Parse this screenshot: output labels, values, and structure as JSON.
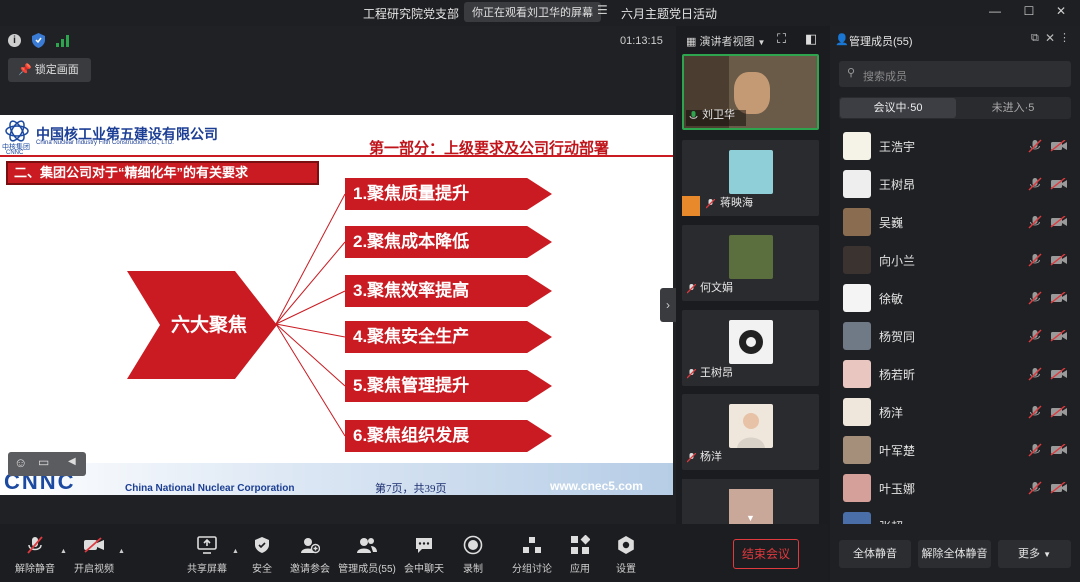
{
  "titlebar": {
    "meeting_org": "工程研究院党支部",
    "viewing_notice": "你正在观看刘卫华的屏幕",
    "meeting_title": "六月主题党日活动"
  },
  "stage": {
    "timer": "01:13:15",
    "lock_label": "锁定画面"
  },
  "view_controls": {
    "speaker_view": "演讲者视图"
  },
  "slide": {
    "company_cn": "中国核工业第五建设有限公司",
    "company_en": "China Nuclear Industry Fifth Construction CO., LTD.",
    "logo_group": "中核集团",
    "logo_cnnc": "CNNC",
    "part_title": "第一部分：上级要求及公司行动部署",
    "section_title": "二、集团公司对于“精细化年”的有关要求",
    "center_label": "六大聚焦",
    "items": [
      "1.聚焦质量提升",
      "2.聚焦成本降低",
      "3.聚焦效率提高",
      "4.聚焦安全生产",
      "5.聚焦管理提升",
      "6.聚焦组织发展"
    ],
    "footer_logo": "CNNC",
    "footer_corp": "China National Nuclear Corporation",
    "footer_page": "第7页，共39页",
    "footer_url": "www.cnec5.com"
  },
  "thumbnails": [
    {
      "name": "刘卫华",
      "active": true
    },
    {
      "name": "蒋映海"
    },
    {
      "name": "何文娟"
    },
    {
      "name": "王树昂"
    },
    {
      "name": "杨洋"
    }
  ],
  "members_panel": {
    "title": "管理成员(55)",
    "search_placeholder": "搜索成员",
    "tab_in": "会议中·50",
    "tab_out": "未进入·5",
    "members": [
      "王浩宇",
      "王树昂",
      "吴巍",
      "向小兰",
      "徐敏",
      "杨贺同",
      "杨若昕",
      "杨洋",
      "叶军楚",
      "叶玉娜",
      "张超"
    ],
    "mute_all": "全体静音",
    "unmute_all": "解除全体静音",
    "more": "更多"
  },
  "toolbar": {
    "unmute": "解除静音",
    "start_video": "开启视频",
    "share_screen": "共享屏幕",
    "security": "安全",
    "invite": "邀请参会",
    "manage_members": "管理成员(55)",
    "chat": "会中聊天",
    "record": "录制",
    "breakout": "分组讨论",
    "apps": "应用",
    "settings": "设置",
    "end_meeting": "结束会议"
  },
  "colors": {
    "accent_red": "#c91b21",
    "end_button_red": "#e0393e",
    "active_green": "#2ea44f"
  }
}
